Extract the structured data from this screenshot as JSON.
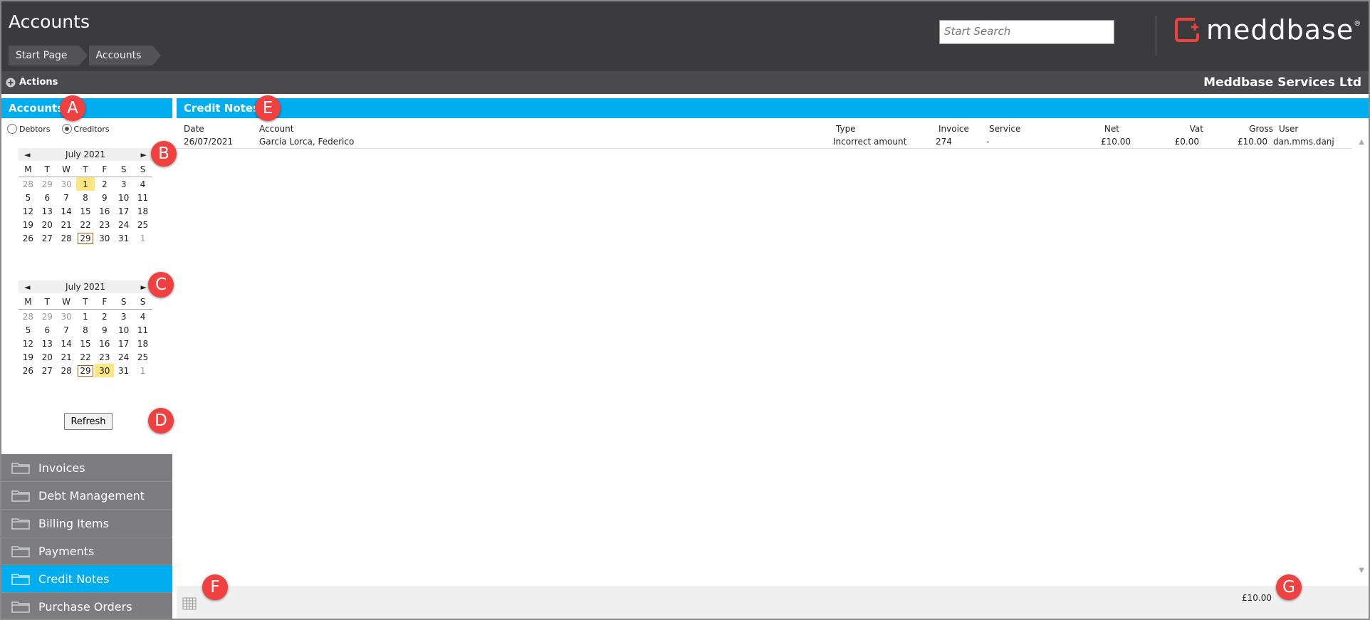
{
  "header": {
    "title": "Accounts",
    "breadcrumb": [
      "Start Page",
      "Accounts"
    ],
    "search_placeholder": "Start Search",
    "logo_text": "meddbase",
    "logo_reg": "®"
  },
  "actions_bar": {
    "actions_label": "Actions",
    "company": "Meddbase Services Ltd"
  },
  "sidebar": {
    "panel_title": "Accounts",
    "radio_debtors": "Debtors",
    "radio_creditors": "Creditors",
    "selected_radio": "Creditors",
    "cal_from": {
      "month": "July 2021",
      "prev": "◄",
      "next": "►",
      "weekdays": [
        "M",
        "T",
        "W",
        "T",
        "F",
        "S",
        "S"
      ],
      "weeks": [
        [
          "28",
          "29",
          "30",
          "1",
          "2",
          "3",
          "4"
        ],
        [
          "5",
          "6",
          "7",
          "8",
          "9",
          "10",
          "11"
        ],
        [
          "12",
          "13",
          "14",
          "15",
          "16",
          "17",
          "18"
        ],
        [
          "19",
          "20",
          "21",
          "22",
          "23",
          "24",
          "25"
        ],
        [
          "26",
          "27",
          "28",
          "29",
          "30",
          "31",
          "1"
        ]
      ],
      "highlighted": "1",
      "today": "29"
    },
    "cal_to": {
      "month": "July 2021",
      "prev": "◄",
      "next": "►",
      "weekdays": [
        "M",
        "T",
        "W",
        "T",
        "F",
        "S",
        "S"
      ],
      "weeks": [
        [
          "28",
          "29",
          "30",
          "1",
          "2",
          "3",
          "4"
        ],
        [
          "5",
          "6",
          "7",
          "8",
          "9",
          "10",
          "11"
        ],
        [
          "12",
          "13",
          "14",
          "15",
          "16",
          "17",
          "18"
        ],
        [
          "19",
          "20",
          "21",
          "22",
          "23",
          "24",
          "25"
        ],
        [
          "26",
          "27",
          "28",
          "29",
          "30",
          "31",
          "1"
        ]
      ],
      "highlighted": "30",
      "today": "29"
    },
    "refresh_label": "Refresh",
    "nav": [
      {
        "label": "Invoices",
        "active": false
      },
      {
        "label": "Debt Management",
        "active": false
      },
      {
        "label": "Billing Items",
        "active": false
      },
      {
        "label": "Payments",
        "active": false
      },
      {
        "label": "Credit Notes",
        "active": true
      },
      {
        "label": "Purchase Orders",
        "active": false
      }
    ]
  },
  "main": {
    "panel_title": "Credit Notes",
    "columns": {
      "date": "Date",
      "account": "Account",
      "type": "Type",
      "invoice": "Invoice",
      "service": "Service",
      "net": "Net",
      "vat": "Vat",
      "gross": "Gross",
      "user": "User"
    },
    "rows": [
      {
        "date": "26/07/2021",
        "account": "Garcia Lorca, Federico",
        "type": "Incorrect amount",
        "invoice": "274",
        "service": "-",
        "net": "£10.00",
        "vat": "£0.00",
        "gross": "£10.00",
        "user": "dan.mms.danj"
      }
    ],
    "footer_total": "£10.00",
    "scroll_up": "▲",
    "scroll_down": "▼"
  },
  "markers": [
    "A",
    "B",
    "C",
    "D",
    "E",
    "F",
    "G"
  ],
  "colors": {
    "accent": "#00aeef",
    "header": "#3b3b3d",
    "logo_red": "#f04040",
    "marker": "#f04040",
    "highlight": "#ffe680"
  }
}
